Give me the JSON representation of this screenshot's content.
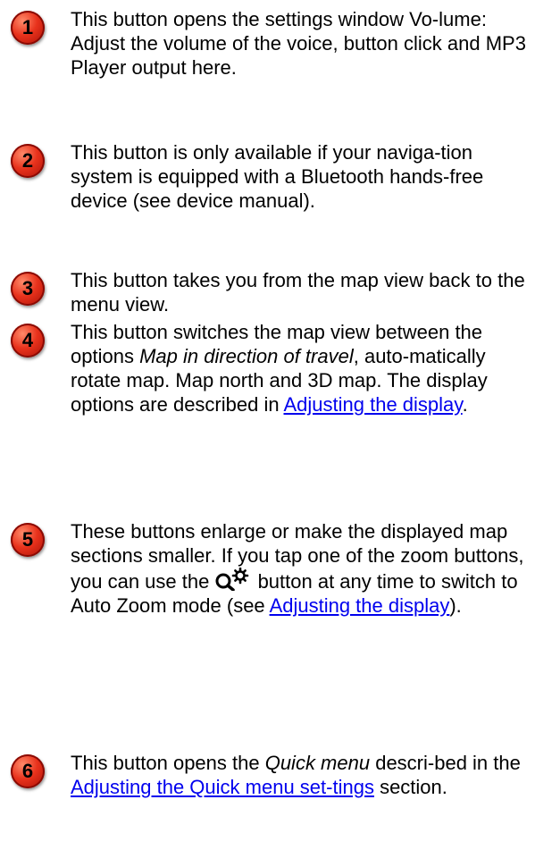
{
  "items": [
    {
      "number": "1",
      "text": "This button opens the settings window Vo-lume: Adjust the volume of the voice, button click and MP3 Player output here."
    },
    {
      "number": "2",
      "text": "This button is only available if your naviga-tion system is equipped with a Bluetooth hands-free device (see device manual)."
    },
    {
      "number": "3",
      "text": "This button takes you from the map view back to the menu view."
    },
    {
      "number": "4",
      "text_before": "This button switches the map view between the options ",
      "italic": "Map in direction of travel",
      "text_middle": ", auto-matically rotate map. Map north and 3D map. The display options are described in ",
      "link": "Adjusting the display",
      "text_after": "."
    },
    {
      "number": "5",
      "text_before": "These buttons enlarge or make the displayed map sections smaller. If you tap one of the zoom buttons, you can use the ",
      "icon": "auto-zoom-icon",
      "text_middle": " button at any time to switch to Auto Zoom mode (see ",
      "link": "Adjusting the display",
      "text_after": ")."
    },
    {
      "number": "6",
      "text_before": "This button opens the ",
      "italic": "Quick menu",
      "text_middle": " descri-bed in the ",
      "link": "Adjusting the Quick menu set-tings",
      "text_after": " section."
    }
  ]
}
